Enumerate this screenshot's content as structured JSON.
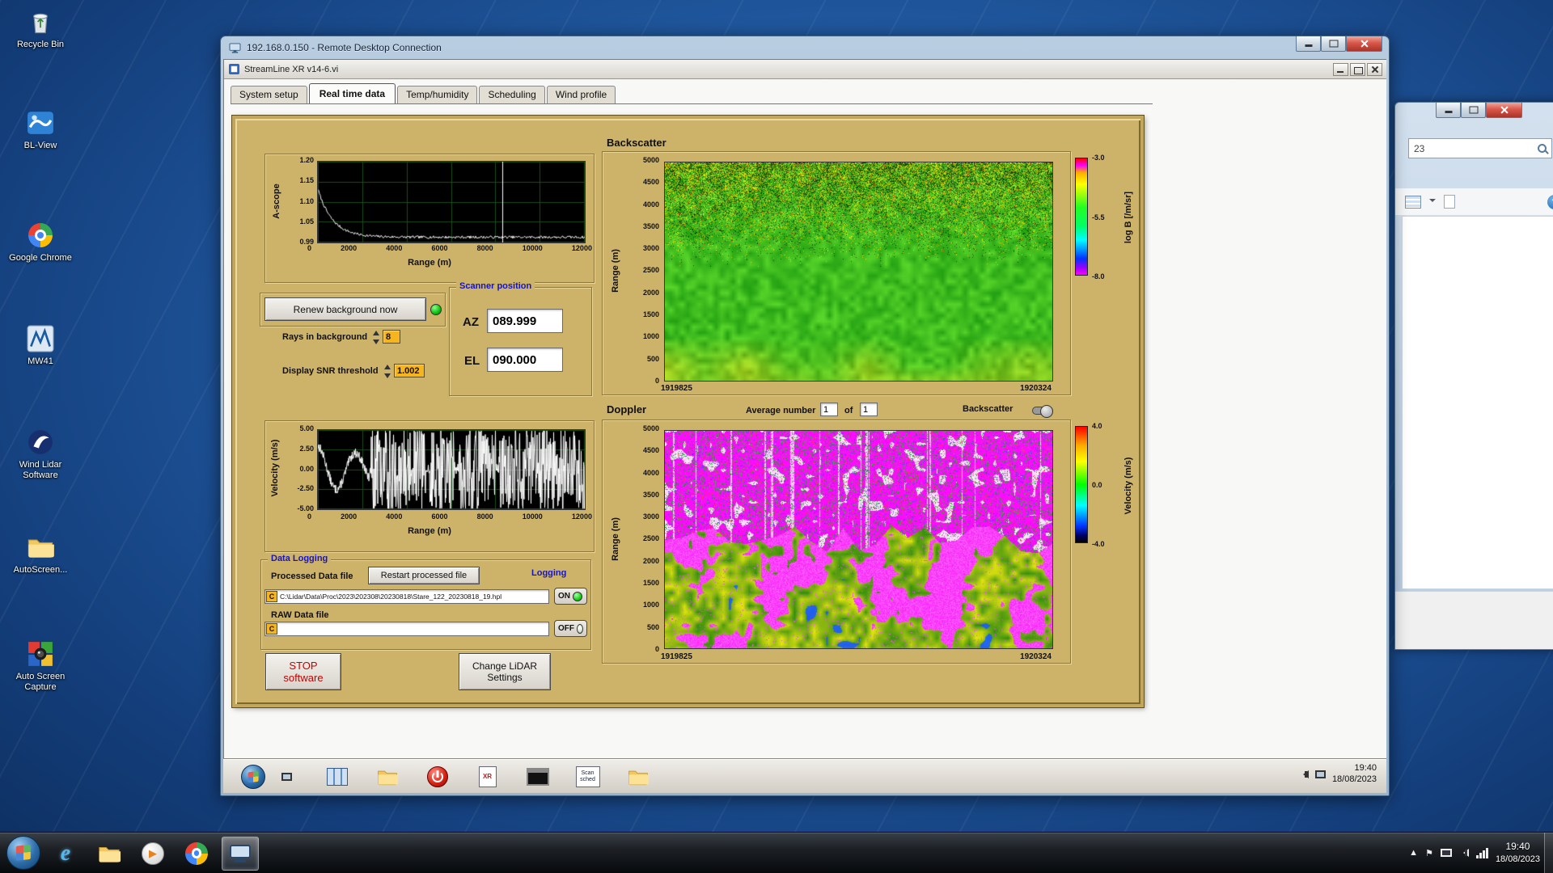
{
  "desktop": {
    "icons": [
      {
        "label": "Recycle Bin"
      },
      {
        "label": "BL-View"
      },
      {
        "label": "Google Chrome"
      },
      {
        "label": "MW41"
      },
      {
        "label": "Wind Lidar Software"
      },
      {
        "label": "AutoScreen..."
      },
      {
        "label": "Auto Screen Capture"
      }
    ]
  },
  "system_taskbar": {
    "time": "19:40",
    "date": "18/08/2023"
  },
  "rdp": {
    "title": "192.168.0.150 - Remote Desktop Connection",
    "remote_taskbar": {
      "time": "19:40",
      "date": "18/08/2023",
      "scan_label": "Scan sched"
    }
  },
  "side_window": {
    "search_text": "23",
    "help_glyph": "?"
  },
  "app": {
    "title": "StreamLine XR v14-6.vi",
    "tabs": [
      "System setup",
      "Real time data",
      "Temp/humidity",
      "Scheduling",
      "Wind profile"
    ],
    "backscatter_title": "Backscatter",
    "doppler_title": "Doppler",
    "ascope": {
      "ylabel": "A-scope",
      "xlabel": "Range (m)",
      "yticks": [
        "1.20",
        "1.15",
        "1.10",
        "1.05",
        "0.99"
      ],
      "xticks": [
        "0",
        "2000",
        "4000",
        "6000",
        "8000",
        "10000",
        "12000"
      ]
    },
    "velocity": {
      "ylabel": "Velocity (m/s)",
      "xlabel": "Range (m)",
      "yticks": [
        "5.00",
        "2.50",
        "0.00",
        "-2.50",
        "-5.00"
      ],
      "xticks": [
        "0",
        "2000",
        "4000",
        "6000",
        "8000",
        "10000",
        "12000"
      ]
    },
    "bs_map": {
      "ylabel": "Range (m)",
      "yticks": [
        "5000",
        "4500",
        "4000",
        "3500",
        "3000",
        "2500",
        "2000",
        "1500",
        "1000",
        "500",
        "0"
      ],
      "x_start": "1919825",
      "x_end": "1920324",
      "cbar_ticks": [
        "-3.0",
        "-5.5",
        "-8.0"
      ],
      "cbar_label": "log B [/m/sr]"
    },
    "dp_map": {
      "ylabel": "Range (m)",
      "yticks": [
        "5000",
        "4500",
        "4000",
        "3500",
        "3000",
        "2500",
        "2000",
        "1500",
        "1000",
        "500",
        "0"
      ],
      "x_start": "1919825",
      "x_end": "1920324",
      "cbar_ticks": [
        "4.0",
        "0.0",
        "-4.0"
      ],
      "cbar_label": "Velocity (m/s)"
    },
    "controls": {
      "renew_button": "Renew background now",
      "rays_label": "Rays in background",
      "rays_value": "8",
      "snr_label": "Display SNR threshold",
      "snr_value": "1.002",
      "scanner_title": "Scanner position",
      "az_label": "AZ",
      "az_value": "089.999",
      "el_label": "EL",
      "el_value": "090.000",
      "avg_label": "Average number",
      "avg_value": "1",
      "of_label": "of",
      "avg_total": "1",
      "bs_toggle_label": "Backscatter"
    },
    "logging": {
      "group_title": "Data Logging",
      "processed_label": "Processed Data file",
      "restart_button": "Restart processed file",
      "drive_label": "C",
      "processed_path": "C:\\Lidar\\Data\\Proc\\2023\\202308\\20230818\\Stare_122_20230818_19.hpl",
      "raw_label": "RAW Data file",
      "logging_label": "Logging",
      "on_label": "ON",
      "off_label": "OFF"
    },
    "stop_button": "STOP software",
    "settings_button": "Change LiDAR Settings"
  },
  "chart_data": [
    {
      "type": "line",
      "title": "A-scope",
      "xlabel": "Range (m)",
      "ylabel": "A-scope",
      "xlim": [
        0,
        12000
      ],
      "ylim": [
        0.99,
        1.2
      ],
      "xticks": [
        0,
        2000,
        4000,
        6000,
        8000,
        10000,
        12000
      ],
      "yticks": [
        1.2,
        1.15,
        1.1,
        1.05,
        0.99
      ],
      "grid": true,
      "description": "White background trace starting near 1.13 at range 0, decaying to ~1.00 by 2500 m, then flat noisy ~1.00 out to 12000 m; vertical cursor line near 8300 m"
    },
    {
      "type": "heatmap",
      "title": "Backscatter",
      "ylabel": "Range (m)",
      "ylim": [
        0,
        5000
      ],
      "x_start": 1919825,
      "x_end": 1920324,
      "colorbar_label": "log B [/m/sr]",
      "colorbar_ticks": [
        -3.0,
        -5.5,
        -8.0
      ],
      "description": "Uniform green backscatter (~ -5.5) below ~3000 m, speckled yellow/dark noise above ~3000 m, faint yellow tint near the surface"
    },
    {
      "type": "line",
      "title": "Velocity",
      "xlabel": "Range (m)",
      "ylabel": "Velocity (m/s)",
      "xlim": [
        0,
        12000
      ],
      "ylim": [
        -5,
        5
      ],
      "xticks": [
        0,
        2000,
        4000,
        6000,
        8000,
        10000,
        12000
      ],
      "yticks": [
        5.0,
        2.5,
        0.0,
        -2.5,
        -5.0
      ],
      "grid": true,
      "description": "Coherent velocities within ±3 m/s below ~2400 m, saturated full-scale noise beyond"
    },
    {
      "type": "heatmap",
      "title": "Doppler",
      "ylabel": "Range (m)",
      "ylim": [
        0,
        5000
      ],
      "x_start": 1919825,
      "x_end": 1920324,
      "colorbar_label": "Velocity (m/s)",
      "colorbar_ticks": [
        4.0,
        0.0,
        -4.0
      ],
      "description": "Magenta saturated noise with white vertical streaks above ~2500 m; green/yellow coherent flow with magenta blobs and blue patches below"
    }
  ]
}
